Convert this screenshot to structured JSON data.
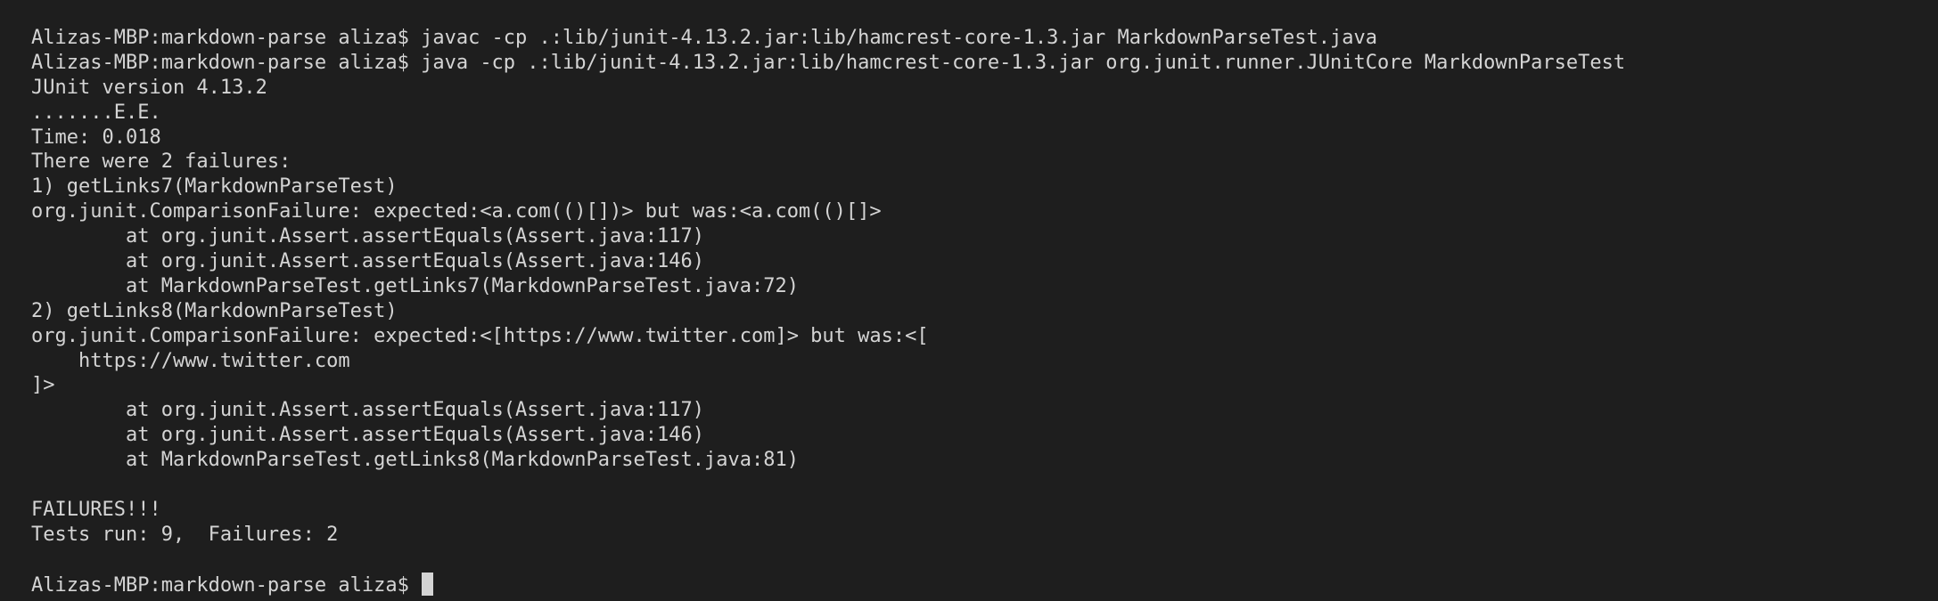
{
  "terminal": {
    "lines": [
      "Alizas-MBP:markdown-parse aliza$ javac -cp .:lib/junit-4.13.2.jar:lib/hamcrest-core-1.3.jar MarkdownParseTest.java",
      "Alizas-MBP:markdown-parse aliza$ java -cp .:lib/junit-4.13.2.jar:lib/hamcrest-core-1.3.jar org.junit.runner.JUnitCore MarkdownParseTest",
      "JUnit version 4.13.2",
      ".......E.E.",
      "Time: 0.018",
      "There were 2 failures:",
      "1) getLinks7(MarkdownParseTest)",
      "org.junit.ComparisonFailure: expected:<a.com(()[])> but was:<a.com(()[]>",
      "        at org.junit.Assert.assertEquals(Assert.java:117)",
      "        at org.junit.Assert.assertEquals(Assert.java:146)",
      "        at MarkdownParseTest.getLinks7(MarkdownParseTest.java:72)",
      "2) getLinks8(MarkdownParseTest)",
      "org.junit.ComparisonFailure: expected:<[https://www.twitter.com]> but was:<[",
      "    https://www.twitter.com",
      "]>",
      "        at org.junit.Assert.assertEquals(Assert.java:117)",
      "        at org.junit.Assert.assertEquals(Assert.java:146)",
      "        at MarkdownParseTest.getLinks8(MarkdownParseTest.java:81)",
      "",
      "FAILURES!!!",
      "Tests run: 9,  Failures: 2",
      ""
    ],
    "prompt": "Alizas-MBP:markdown-parse aliza$ ",
    "colors": {
      "background": "#1e1e1e",
      "text": "#d4d4d4",
      "cursor": "#d4d4d4"
    }
  }
}
